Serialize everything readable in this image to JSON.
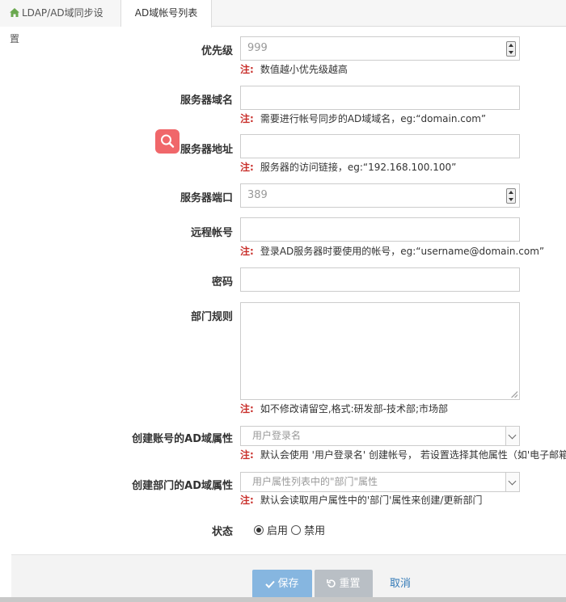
{
  "tabs": [
    {
      "label": "LDAP/AD域同步设置"
    },
    {
      "label": "AD域帐号列表"
    }
  ],
  "form": {
    "priority": {
      "label": "优先级",
      "value": "999",
      "note_mark": "注:",
      "note": "数值越小优先级越高"
    },
    "domain": {
      "label": "服务器域名",
      "value": "",
      "note_mark": "注:",
      "note": "需要进行帐号同步的AD域域名，eg:“domain.com”"
    },
    "address": {
      "label": "服务器地址",
      "value": "",
      "note_mark": "注:",
      "note": "服务器的访问链接，eg:“192.168.100.100”"
    },
    "port": {
      "label": "服务器端口",
      "value": "389"
    },
    "account": {
      "label": "远程帐号",
      "value": "",
      "note_mark": "注:",
      "note": "登录AD服务器时要使用的帐号，eg:“username@domain.com”"
    },
    "password": {
      "label": "密码",
      "value": ""
    },
    "dept_rule": {
      "label": "部门规则",
      "value": "",
      "note_mark": "注:",
      "note": "如不修改请留空,格式:研发部-技术部;市场部"
    },
    "account_attr": {
      "label": "创建账号的AD域属性",
      "selected": "用户登录名",
      "note_mark": "注:",
      "note": "默认会使用 '用户登录名' 创建帐号， 若设置选择其他属性（如'电子邮箱'）"
    },
    "dept_attr": {
      "label": "创建部门的AD域属性",
      "selected": "用户属性列表中的\"部门\"属性",
      "note_mark": "注:",
      "note": "默认会读取用户属性中的'部门'属性来创建/更新部门"
    },
    "status": {
      "label": "状态",
      "options": [
        {
          "label": "启用",
          "checked": true
        },
        {
          "label": "禁用",
          "checked": false
        }
      ]
    }
  },
  "buttons": {
    "save": "保存",
    "reset": "重置",
    "cancel": "取消"
  },
  "colors": {
    "note_mark": "#c9302c",
    "save": "#86b6e0",
    "reset": "#b9bfc5",
    "link": "#337ab7",
    "search_badge": "#f0676a"
  }
}
